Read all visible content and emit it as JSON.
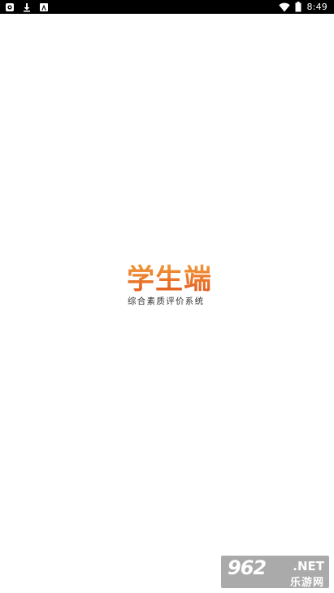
{
  "status_bar": {
    "time": "8:49",
    "left_icons": [
      "app-notification-icon",
      "download-icon",
      "font-icon"
    ],
    "right_icons": [
      "wifi-icon",
      "battery-icon"
    ]
  },
  "splash": {
    "title": "学生端",
    "subtitle": "综合素质评价系统",
    "colors": {
      "title_top": "#f29a3a",
      "title_bottom": "#e2571c",
      "subtitle": "#333333"
    }
  },
  "watermark": {
    "number": "962",
    "domain": ".NET",
    "name": "乐游网"
  }
}
